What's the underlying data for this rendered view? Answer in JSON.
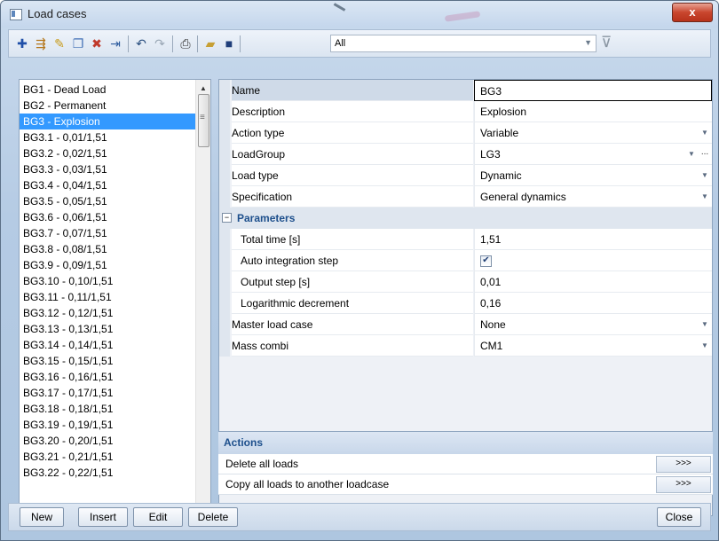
{
  "window": {
    "title": "Load cases",
    "close_label": "x"
  },
  "toolbar": {
    "filter_value": "All"
  },
  "load_cases": [
    "BG1 - Dead Load",
    "BG2 - Permanent",
    "BG3 - Explosion",
    "BG3.1 - 0,01/1,51",
    "BG3.2 - 0,02/1,51",
    "BG3.3 - 0,03/1,51",
    "BG3.4 - 0,04/1,51",
    "BG3.5 - 0,05/1,51",
    "BG3.6 - 0,06/1,51",
    "BG3.7 - 0,07/1,51",
    "BG3.8 - 0,08/1,51",
    "BG3.9 - 0,09/1,51",
    "BG3.10 - 0,10/1,51",
    "BG3.11 - 0,11/1,51",
    "BG3.12 - 0,12/1,51",
    "BG3.13 - 0,13/1,51",
    "BG3.14 - 0,14/1,51",
    "BG3.15 - 0,15/1,51",
    "BG3.16 - 0,16/1,51",
    "BG3.17 - 0,17/1,51",
    "BG3.18 - 0,18/1,51",
    "BG3.19 - 0,19/1,51",
    "BG3.20 - 0,20/1,51",
    "BG3.21 - 0,21/1,51",
    "BG3.22 - 0,22/1,51"
  ],
  "selected_index": 2,
  "properties": {
    "name": {
      "label": "Name",
      "value": "BG3"
    },
    "description": {
      "label": "Description",
      "value": "Explosion"
    },
    "action_type": {
      "label": "Action type",
      "value": "Variable"
    },
    "load_group": {
      "label": "LoadGroup",
      "value": "LG3"
    },
    "load_type": {
      "label": "Load type",
      "value": "Dynamic"
    },
    "specification": {
      "label": "Specification",
      "value": "General dynamics"
    },
    "parameters_header": "Parameters",
    "total_time": {
      "label": "Total time [s]",
      "value": "1,51"
    },
    "auto_integration": {
      "label": "Auto integration step",
      "checked": true
    },
    "output_step": {
      "label": "Output step [s]",
      "value": "0,01"
    },
    "log_decrement": {
      "label": "Logarithmic decrement",
      "value": "0,16"
    },
    "master_load_case": {
      "label": "Master load case",
      "value": "None"
    },
    "mass_combi": {
      "label": "Mass combi",
      "value": "CM1"
    }
  },
  "actions": {
    "header": "Actions",
    "items": [
      {
        "label": "Delete all loads",
        "button": ">>>"
      },
      {
        "label": "Copy all loads to another loadcase",
        "button": ">>>"
      }
    ]
  },
  "buttons": {
    "new": "New",
    "insert": "Insert",
    "edit": "Edit",
    "delete": "Delete",
    "close": "Close"
  },
  "colors": {
    "selection": "#3399ff",
    "group_label": "#1d4f8c",
    "close_button": "#c9462e"
  }
}
